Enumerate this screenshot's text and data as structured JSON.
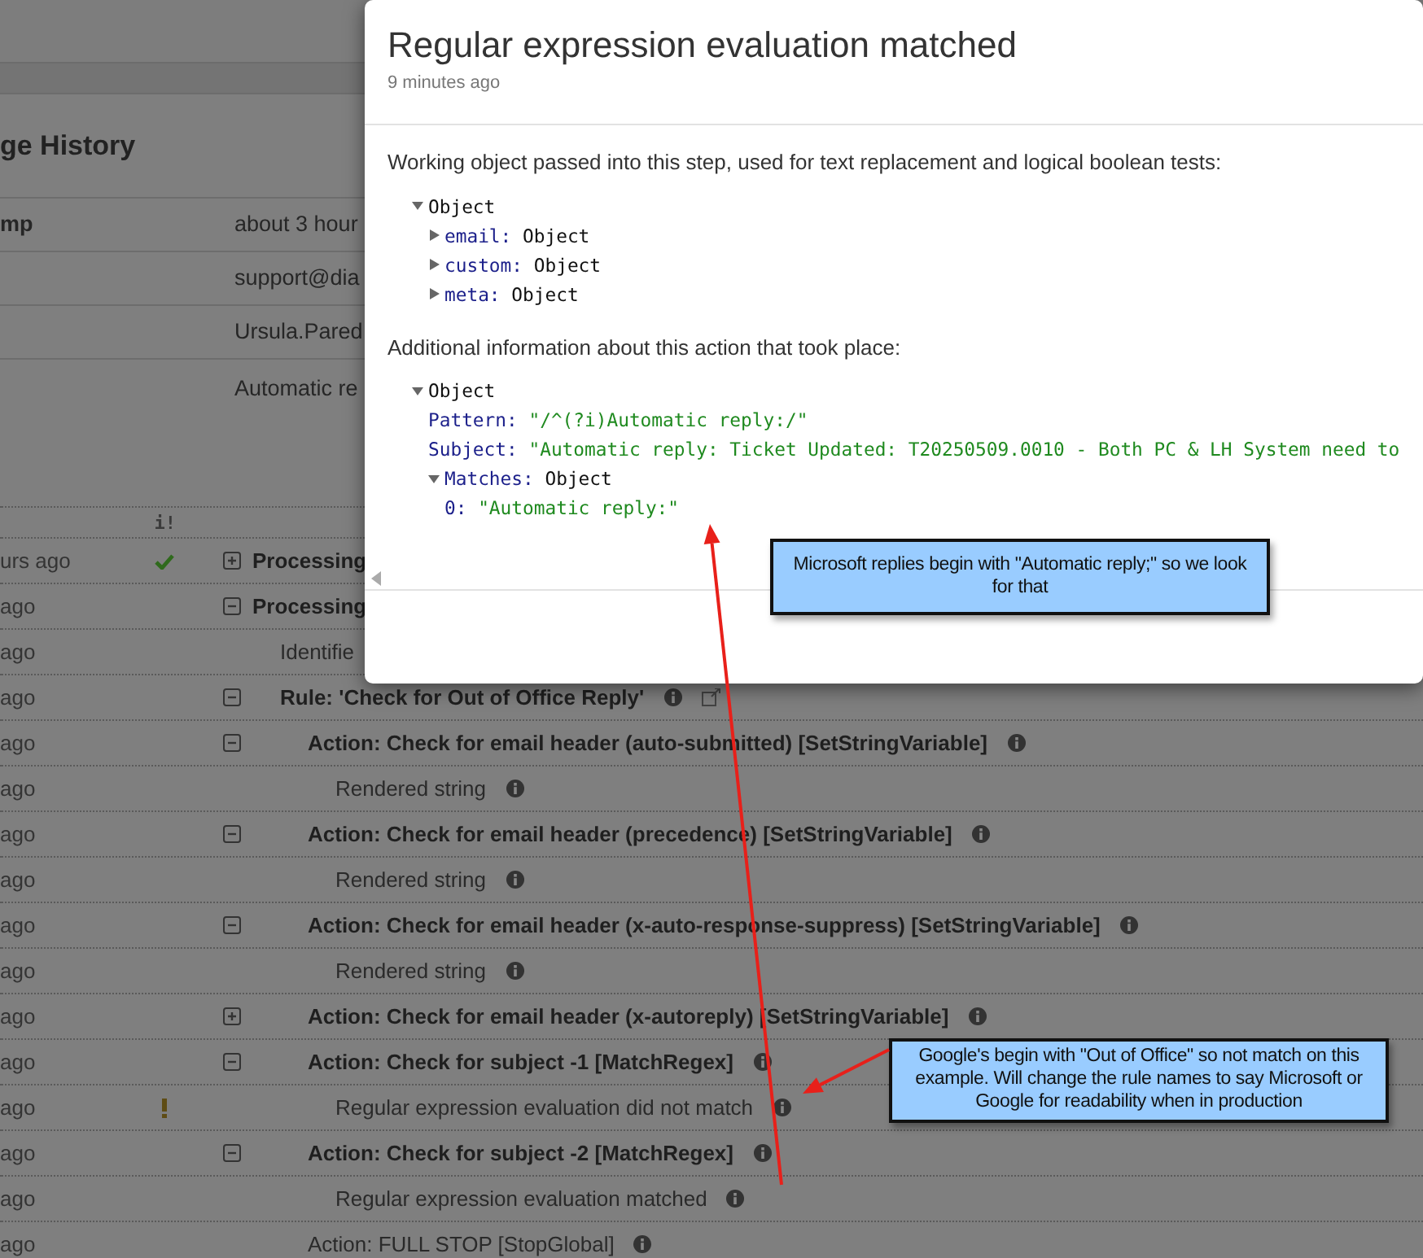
{
  "background": {
    "heading": "ge History",
    "details": [
      {
        "label": "mp",
        "value": "about 3 hour"
      },
      {
        "value": "support@dia"
      },
      {
        "value": "Ursula.Pared"
      },
      {
        "value": "Automatic re"
      }
    ],
    "log": {
      "status_header": "i!",
      "rows": [
        {
          "time": "urs ago",
          "succeeded": true,
          "kind": "group",
          "expanded": false,
          "text": "Processing"
        },
        {
          "time": "ago",
          "kind": "group",
          "expanded": true,
          "text": "Processing",
          "children": [
            {
              "time": "ago",
              "kind": "item",
              "text": "Identifie"
            },
            {
              "time": "ago",
              "kind": "group",
              "expanded": true,
              "text": "Rule: 'Check for Out of Office Reply'",
              "info": true,
              "link_icon": true,
              "children": [
                {
                  "time": "ago",
                  "kind": "group",
                  "expanded": true,
                  "text": "Action: Check for email header (auto-submitted) [SetStringVariable]",
                  "info": true,
                  "children": [
                    {
                      "time": "ago",
                      "kind": "item",
                      "text": "Rendered string",
                      "info": true
                    }
                  ]
                },
                {
                  "time": "ago",
                  "kind": "group",
                  "expanded": true,
                  "text": "Action: Check for email header (precedence) [SetStringVariable]",
                  "info": true,
                  "children": [
                    {
                      "time": "ago",
                      "kind": "item",
                      "text": "Rendered string",
                      "info": true
                    }
                  ]
                },
                {
                  "time": "ago",
                  "kind": "group",
                  "expanded": true,
                  "text": "Action: Check for email header (x-auto-response-suppress) [SetStringVariable]",
                  "info": true,
                  "children": [
                    {
                      "time": "ago",
                      "kind": "item",
                      "text": "Rendered string",
                      "info": true
                    }
                  ]
                },
                {
                  "time": "ago",
                  "kind": "group",
                  "expanded": false,
                  "text": "Action: Check for email header (x-autoreply) [SetStringVariable]",
                  "info": true
                },
                {
                  "time": "ago",
                  "kind": "group",
                  "expanded": true,
                  "text": "Action: Check for subject -1 [MatchRegex]",
                  "info": true,
                  "children": [
                    {
                      "time": "ago",
                      "warning": true,
                      "kind": "item",
                      "text": "Regular expression evaluation did not match",
                      "info": true
                    }
                  ]
                },
                {
                  "time": "ago",
                  "kind": "group",
                  "expanded": true,
                  "text": "Action: Check for subject -2 [MatchRegex]",
                  "info": true,
                  "children": [
                    {
                      "time": "ago",
                      "kind": "item",
                      "text": "Regular expression evaluation matched",
                      "info": true
                    }
                  ]
                },
                {
                  "time": "ago",
                  "kind": "item",
                  "text": "Action: FULL STOP [StopGlobal]",
                  "info": true
                }
              ]
            }
          ]
        }
      ]
    }
  },
  "modal": {
    "title": "Regular expression evaluation matched",
    "subtitle": "9 minutes ago",
    "sections": [
      {
        "intro": "Working object passed into this step, used for text replacement and logical boolean tests:",
        "tree": {
          "value": "Object",
          "kind": "object",
          "expanded": true,
          "children": [
            {
              "key": "email:",
              "value": "Object",
              "kind": "object",
              "expanded": false
            },
            {
              "key": "custom:",
              "value": "Object",
              "kind": "object",
              "expanded": false
            },
            {
              "key": "meta:",
              "value": "Object",
              "kind": "object",
              "expanded": false
            }
          ]
        }
      },
      {
        "intro": "Additional information about this action that took place:",
        "tree": {
          "value": "Object",
          "kind": "object",
          "expanded": true,
          "children": [
            {
              "key": "Pattern:",
              "value": "\"/^(?i)Automatic reply:/\"",
              "kind": "string"
            },
            {
              "key": "Subject:",
              "value": "\"Automatic reply: Ticket Updated: T20250509.0010 - Both PC & LH System need to",
              "kind": "string"
            },
            {
              "key": "Matches:",
              "value": "Object",
              "kind": "object",
              "expanded": true,
              "children": [
                {
                  "key": "0:",
                  "value": "\"Automatic reply:\"",
                  "kind": "string"
                }
              ]
            }
          ]
        }
      }
    ]
  },
  "callouts": [
    {
      "text": "Microsoft replies begin with \"Automatic reply;\" so we look for that"
    },
    {
      "text": "Google's begin with \"Out of Office\" so not match on this example. Will change the rule names to say Microsoft or Google for readability when in production"
    }
  ]
}
